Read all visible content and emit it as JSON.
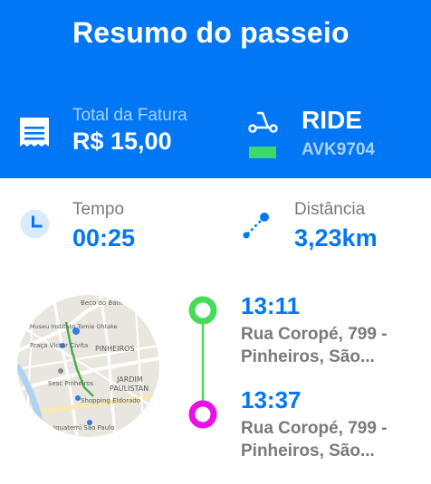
{
  "header": {
    "title": "Resumo do passeio",
    "background_color": "#0277f5"
  },
  "invoice": {
    "icon": "receipt-icon",
    "label": "Total da Fatura",
    "value": "R$ 15,00"
  },
  "vehicle": {
    "icon": "scooter-icon",
    "service": "RIDE",
    "plate": "AVK9704",
    "accent_color": "#3bd86a"
  },
  "time": {
    "icon": "clock-icon",
    "label": "Tempo",
    "value": "00:25"
  },
  "distance": {
    "icon": "route-icon",
    "label": "Distância",
    "value": "3,23km"
  },
  "map": {
    "labels": [
      "Beco do Batman",
      "Museu Instituto Tomie Ohtake",
      "Praça Victor Civita",
      "PINHEIROS",
      "JARDIM",
      "PAULISTAN",
      "Sesc Pinheiros",
      "Shopping Eldorado",
      "Iguatemi São Paulo"
    ]
  },
  "route": {
    "start": {
      "time": "13:11",
      "address": "Rua Coropé, 799 - Pinheiros, São...",
      "color": "#46dc5a"
    },
    "end": {
      "time": "13:37",
      "address": "Rua Coropé, 799 - Pinheiros, São...",
      "color": "#ea0fe8"
    }
  }
}
